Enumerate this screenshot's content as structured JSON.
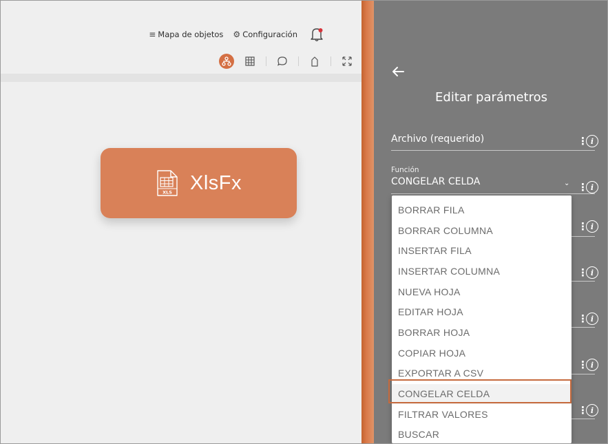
{
  "topnav": {
    "object_map_label": "Mapa de objetos",
    "settings_label": "Configuración"
  },
  "node": {
    "title": "XlsFx",
    "file_icon_text": "XLS"
  },
  "panel": {
    "title": "Editar parámetros",
    "fields": {
      "file_label": "Archivo (requerido)",
      "function_label": "Función",
      "function_value": "CONGELAR CELDA"
    }
  },
  "dropdown": {
    "selected_index": 9,
    "items": [
      "BORRAR FILA",
      "BORRAR COLUMNA",
      "INSERTAR FILA",
      "INSERTAR COLUMNA",
      "NUEVA HOJA",
      "EDITAR HOJA",
      "BORRAR HOJA",
      "COPIAR HOJA",
      "EXPORTAR A CSV",
      "CONGELAR CELDA",
      "FILTRAR VALORES",
      "BUSCAR"
    ]
  },
  "colors": {
    "accent": "#d46f43",
    "node_fill": "#d98158",
    "panel_bg": "#7b7b7b",
    "highlight_border": "#c66a3d"
  },
  "icons": {
    "topnav": [
      "menu-icon",
      "gear-icon",
      "bell-icon"
    ],
    "toolbar": [
      "flow-icon",
      "grid-icon",
      "comment-icon",
      "tag-icon",
      "fullscreen-icon"
    ],
    "panel": [
      "back-arrow-icon",
      "more-options-icon",
      "info-icon",
      "chevron-down-icon"
    ]
  }
}
